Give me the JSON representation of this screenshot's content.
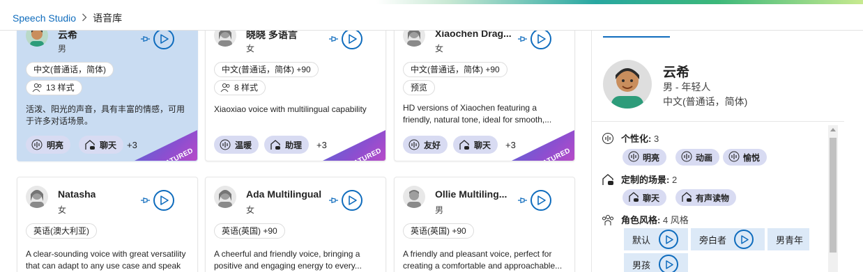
{
  "breadcrumb": {
    "app": "Speech Studio",
    "current": "语音库"
  },
  "cards": [
    {
      "name": "云希",
      "gender": "男",
      "locale": "中文(普通话，简体)",
      "styles": "13 样式",
      "badge2": "",
      "desc": "活泼、阳光的声音，具有丰富的情感，可用于许多对话场景。",
      "pill1": "明亮",
      "pill2": "聊天",
      "more": "+3",
      "featured": "FEATURED"
    },
    {
      "name": "晓晓 多语言",
      "gender": "女",
      "locale": "中文(普通话，简体) +90",
      "styles": "8 样式",
      "badge2": "",
      "desc": "Xiaoxiao voice with multilingual capability",
      "pill1": "温暖",
      "pill2": "助理",
      "more": "+3",
      "featured": "FEATURED"
    },
    {
      "name": "Xiaochen Drag...",
      "gender": "女",
      "locale": "中文(普通话，简体) +90",
      "styles": "",
      "badge2": "预览",
      "desc": "HD versions of Xiaochen featuring a friendly, natural tone, ideal for smooth,...",
      "pill1": "友好",
      "pill2": "聊天",
      "more": "+3",
      "featured": "FEATURED"
    },
    {
      "name": "Natasha",
      "gender": "女",
      "locale": "英语(澳大利亚)",
      "desc": "A clear-sounding voice with great versatility that can adapt to any use case and speak i..."
    },
    {
      "name": "Ada Multilingual",
      "gender": "女",
      "locale": "英语(英国) +90",
      "desc": "A cheerful and friendly voice, bringing a positive and engaging energy to every..."
    },
    {
      "name": "Ollie Multiling...",
      "gender": "男",
      "locale": "英语(英国) +90",
      "desc": "A friendly and pleasant voice, perfect for creating a comfortable and approachable..."
    }
  ],
  "detail": {
    "name": "云希",
    "sub": "男 - 年轻人",
    "locale": "中文(普通话，简体)",
    "personality": {
      "title": "个性化:",
      "count": "3",
      "items": [
        "明亮",
        "动画",
        "愉悦"
      ]
    },
    "scenarios": {
      "title": "定制的场景:",
      "count": "2",
      "items": [
        "聊天",
        "有声读物"
      ]
    },
    "roles": {
      "title": "角色风格:",
      "count": "4 风格",
      "items": [
        "默认",
        "旁白者",
        "男青年",
        "男孩"
      ]
    }
  },
  "colors": {
    "accent": "#0f6cbd",
    "selected_card": "#c9dcf2",
    "pill": "#d8dbf2",
    "role_bg": "#dce9f7"
  }
}
